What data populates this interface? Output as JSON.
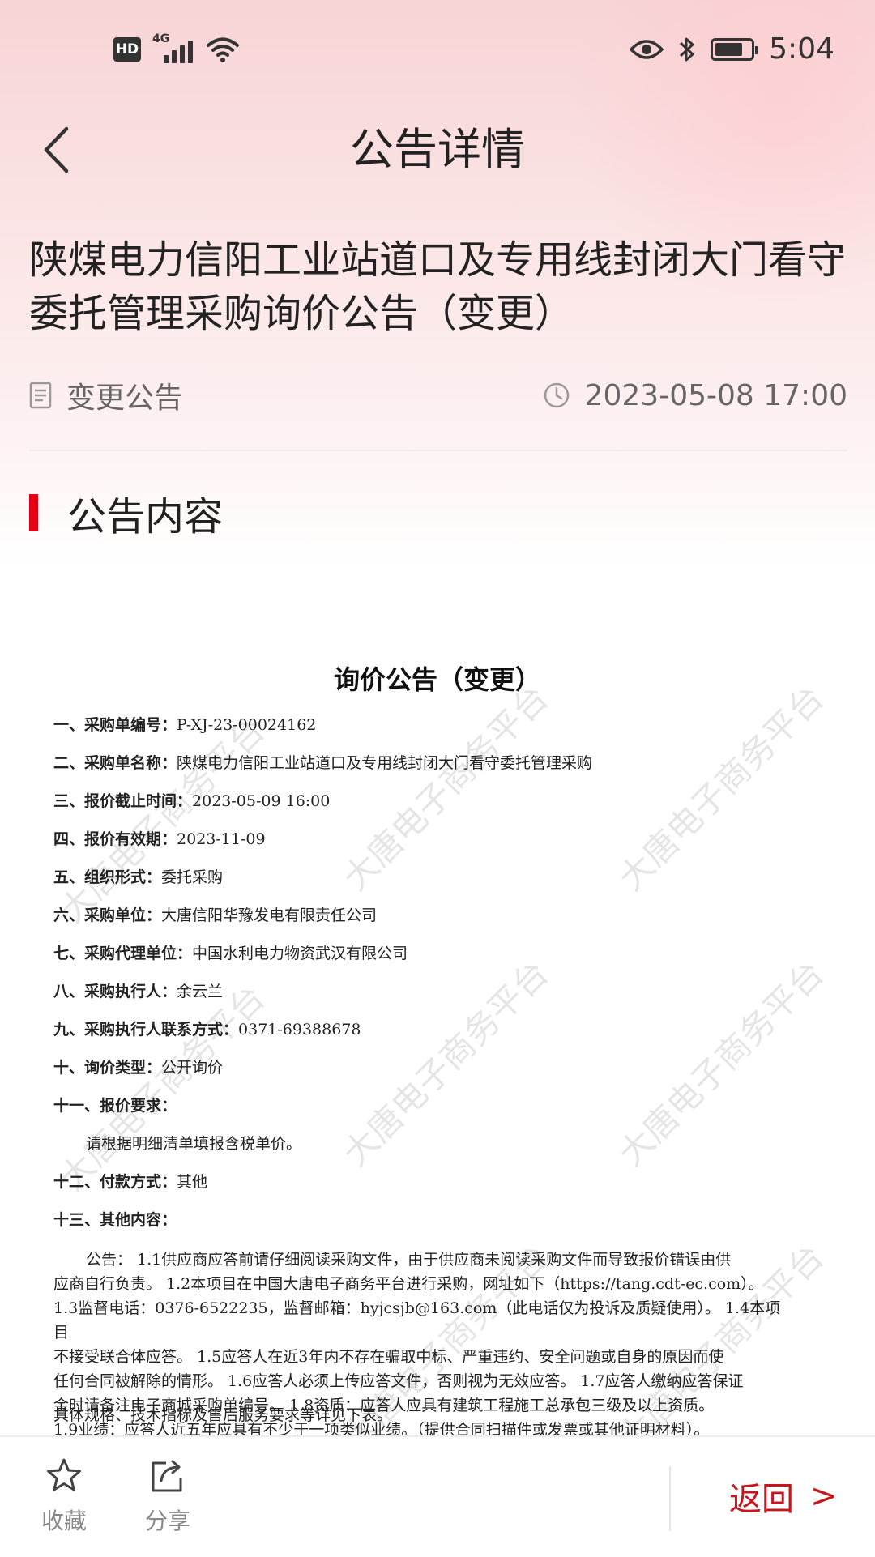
{
  "status_bar": {
    "hd": "HD",
    "network": "4G",
    "time": "5:04"
  },
  "nav": {
    "title": "公告详情"
  },
  "headline": "陕煤电力信阳工业站道口及专用线封闭大门看守委托管理采购询价公告（变更）",
  "meta": {
    "category": "变更公告",
    "datetime": "2023-05-08 17:00"
  },
  "section": {
    "title": "公告内容"
  },
  "document": {
    "title": "询价公告（变更）",
    "items": [
      {
        "label": "一、采购单编号：",
        "value": "P-XJ-23-00024162"
      },
      {
        "label": "二、采购单名称：",
        "value": "陕煤电力信阳工业站道口及专用线封闭大门看守委托管理采购"
      },
      {
        "label": "三、报价截止时间：",
        "value": "2023-05-09 16:00"
      },
      {
        "label": "四、报价有效期：",
        "value": "2023-11-09"
      },
      {
        "label": "五、组织形式：",
        "value": "委托采购"
      },
      {
        "label": "六、采购单位：",
        "value": "大唐信阳华豫发电有限责任公司"
      },
      {
        "label": "七、采购代理单位：",
        "value": "中国水利电力物资武汉有限公司"
      },
      {
        "label": "八、采购执行人：",
        "value": "余云兰"
      },
      {
        "label": "九、采购执行人联系方式：",
        "value": "0371-69388678"
      },
      {
        "label": "十、询价类型：",
        "value": "公开询价"
      },
      {
        "label": "十一、报价要求：",
        "value": ""
      }
    ],
    "quote_requirement": "请根据明细清单填报含税单价。",
    "item12": {
      "label": "十二、付款方式：",
      "value": "其他"
    },
    "item13": {
      "label": "十三、其他内容：",
      "value": ""
    },
    "paragraph": [
      "公告： 1.1供应商应答前请仔细阅读采购文件，由于供应商未阅读采购文件而导致报价错误由供",
      "应商自行负责。 1.2本项目在中国大唐电子商务平台进行采购，网址如下（https://tang.cdt-ec.com）。",
      "1.3监督电话：0376-6522235，监督邮箱：hyjcsjb@163.com（此电话仅为投诉及质疑使用）。 1.4本项目",
      "不接受联合体应答。 1.5应答人在近3年内不存在骗取中标、严重违约、安全问题或自身的原因而使",
      "任何合同被解除的情形。 1.6应答人必须上传应答文件，否则视为无效应答。 1.7应答人缴纳应答保证",
      "金时请备注电子商城采购单编号。 1.8资质：应答人应具有建筑工程施工总承包三级及以上资质。",
      "1.9业绩：应答人近五年应具有不少于一项类似业绩。（提供合同扫描件或发票或其他证明材料）。"
    ],
    "last_line": "具体规格、技术指标及售后服务要求等详见下表。",
    "watermark": "大唐电子商务平台"
  },
  "bottom_bar": {
    "favorite_label": "收藏",
    "share_label": "分享",
    "return_label": "返回",
    "return_arrow": ">"
  },
  "colors": {
    "accent": "#e60012",
    "return_text": "#c8161d"
  }
}
